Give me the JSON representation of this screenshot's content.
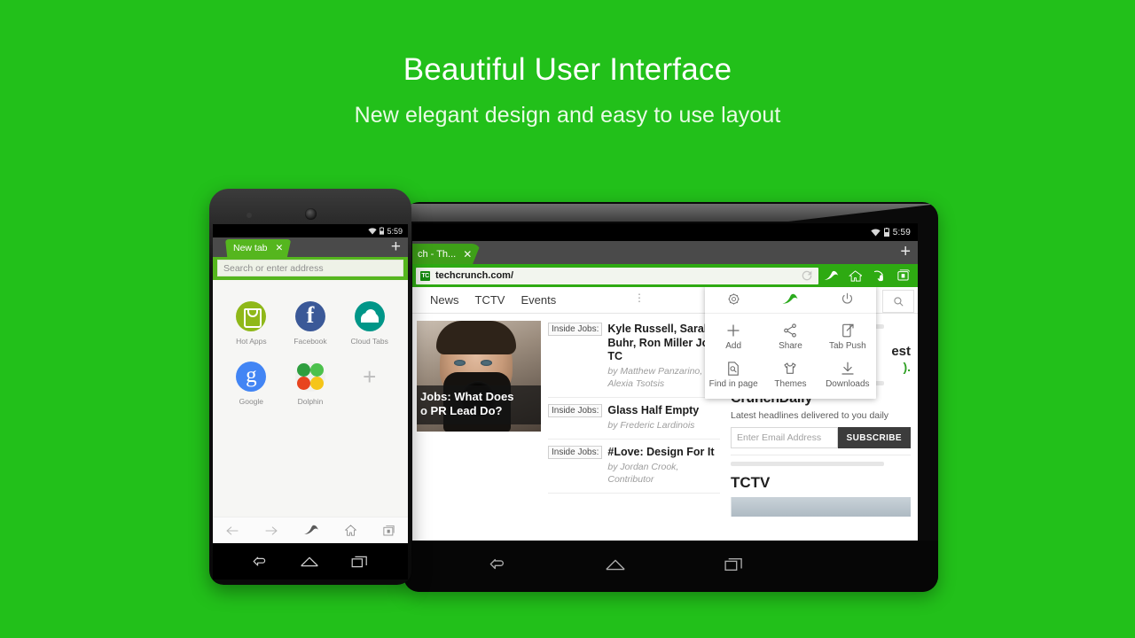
{
  "promo": {
    "headline": "Beautiful User Interface",
    "subhead": "New elegant design and easy to use layout",
    "background_color": "#22c01a"
  },
  "phone": {
    "status": {
      "clock": "5:59",
      "wifi_icon": "wifi-icon",
      "battery_icon": "battery-icon"
    },
    "tab": {
      "title": "New tab",
      "close_icon": "close-icon"
    },
    "new_tab_button": "+",
    "address_bar": {
      "placeholder": "Search or enter address",
      "value": ""
    },
    "speed_dial": [
      {
        "label": "Hot Apps",
        "icon": "hot-apps-icon"
      },
      {
        "label": "Facebook",
        "icon": "facebook-icon"
      },
      {
        "label": "Cloud Tabs",
        "icon": "cloud-tabs-icon"
      },
      {
        "label": "Google",
        "icon": "google-icon"
      },
      {
        "label": "Dolphin",
        "icon": "dolphin-icon"
      },
      {
        "label": "",
        "icon": "add-icon"
      }
    ],
    "bottom_bar": [
      "back-icon",
      "forward-icon",
      "dolphin-icon",
      "home-icon",
      "tabs-icon"
    ],
    "system_nav": [
      "back-icon",
      "home-icon",
      "recents-icon"
    ]
  },
  "tablet": {
    "status": {
      "clock": "5:59",
      "wifi_icon": "wifi-icon",
      "battery_icon": "battery-icon"
    },
    "tab": {
      "title": "ch - Th...",
      "close_icon": "close-icon"
    },
    "new_tab_button": "+",
    "address_bar": {
      "favicon_text": "TC",
      "url": "techcrunch.com/",
      "reload_icon": "reload-icon"
    },
    "toolbar_icons": [
      "dolphin-icon",
      "home-icon",
      "gesture-icon",
      "tabs-icon"
    ],
    "site_nav": [
      "News",
      "TCTV",
      "Events"
    ],
    "site_nav_more": "kebab-menu-icon",
    "search_icon": "search-icon",
    "hero": {
      "headline_line1": "Jobs: What Does",
      "headline_line2": "o PR Lead Do?"
    },
    "stories": [
      {
        "tag": "Inside Jobs:",
        "title": "Kyle Russell, Sarah Buhr, Ron Miller Join TC",
        "byline": "by Matthew Panzarino, Alexia Tsotsis"
      },
      {
        "tag": "Inside Jobs:",
        "title": "Glass Half Empty",
        "byline": "by Frederic Lardinois"
      },
      {
        "tag": "Inside Jobs:",
        "title": "#Love: Design For It",
        "byline": "by Jordan Crook, Contributor"
      }
    ],
    "sidebar": {
      "fragment_text": "est",
      "fragment_green": ").",
      "crunchdaily_title": "CrunchDaily",
      "crunchdaily_sub": "Latest headlines delivered to you daily",
      "email_placeholder": "Enter Email Address",
      "subscribe_label": "SUBSCRIBE",
      "tctv_title": "TCTV"
    },
    "menu": {
      "top_row": [
        {
          "name": "settings-icon",
          "label": "Settings"
        },
        {
          "name": "dolphin-icon",
          "label": "Dolphin"
        },
        {
          "name": "power-icon",
          "label": "Exit"
        }
      ],
      "items": [
        {
          "label": "Add",
          "icon": "add-icon"
        },
        {
          "label": "Share",
          "icon": "share-icon"
        },
        {
          "label": "Tab Push",
          "icon": "tab-push-icon"
        },
        {
          "label": "Find in page",
          "icon": "find-in-page-icon"
        },
        {
          "label": "Themes",
          "icon": "themes-icon"
        },
        {
          "label": "Downloads",
          "icon": "downloads-icon"
        }
      ]
    },
    "system_nav": [
      "back-icon",
      "home-icon",
      "recents-icon"
    ]
  }
}
